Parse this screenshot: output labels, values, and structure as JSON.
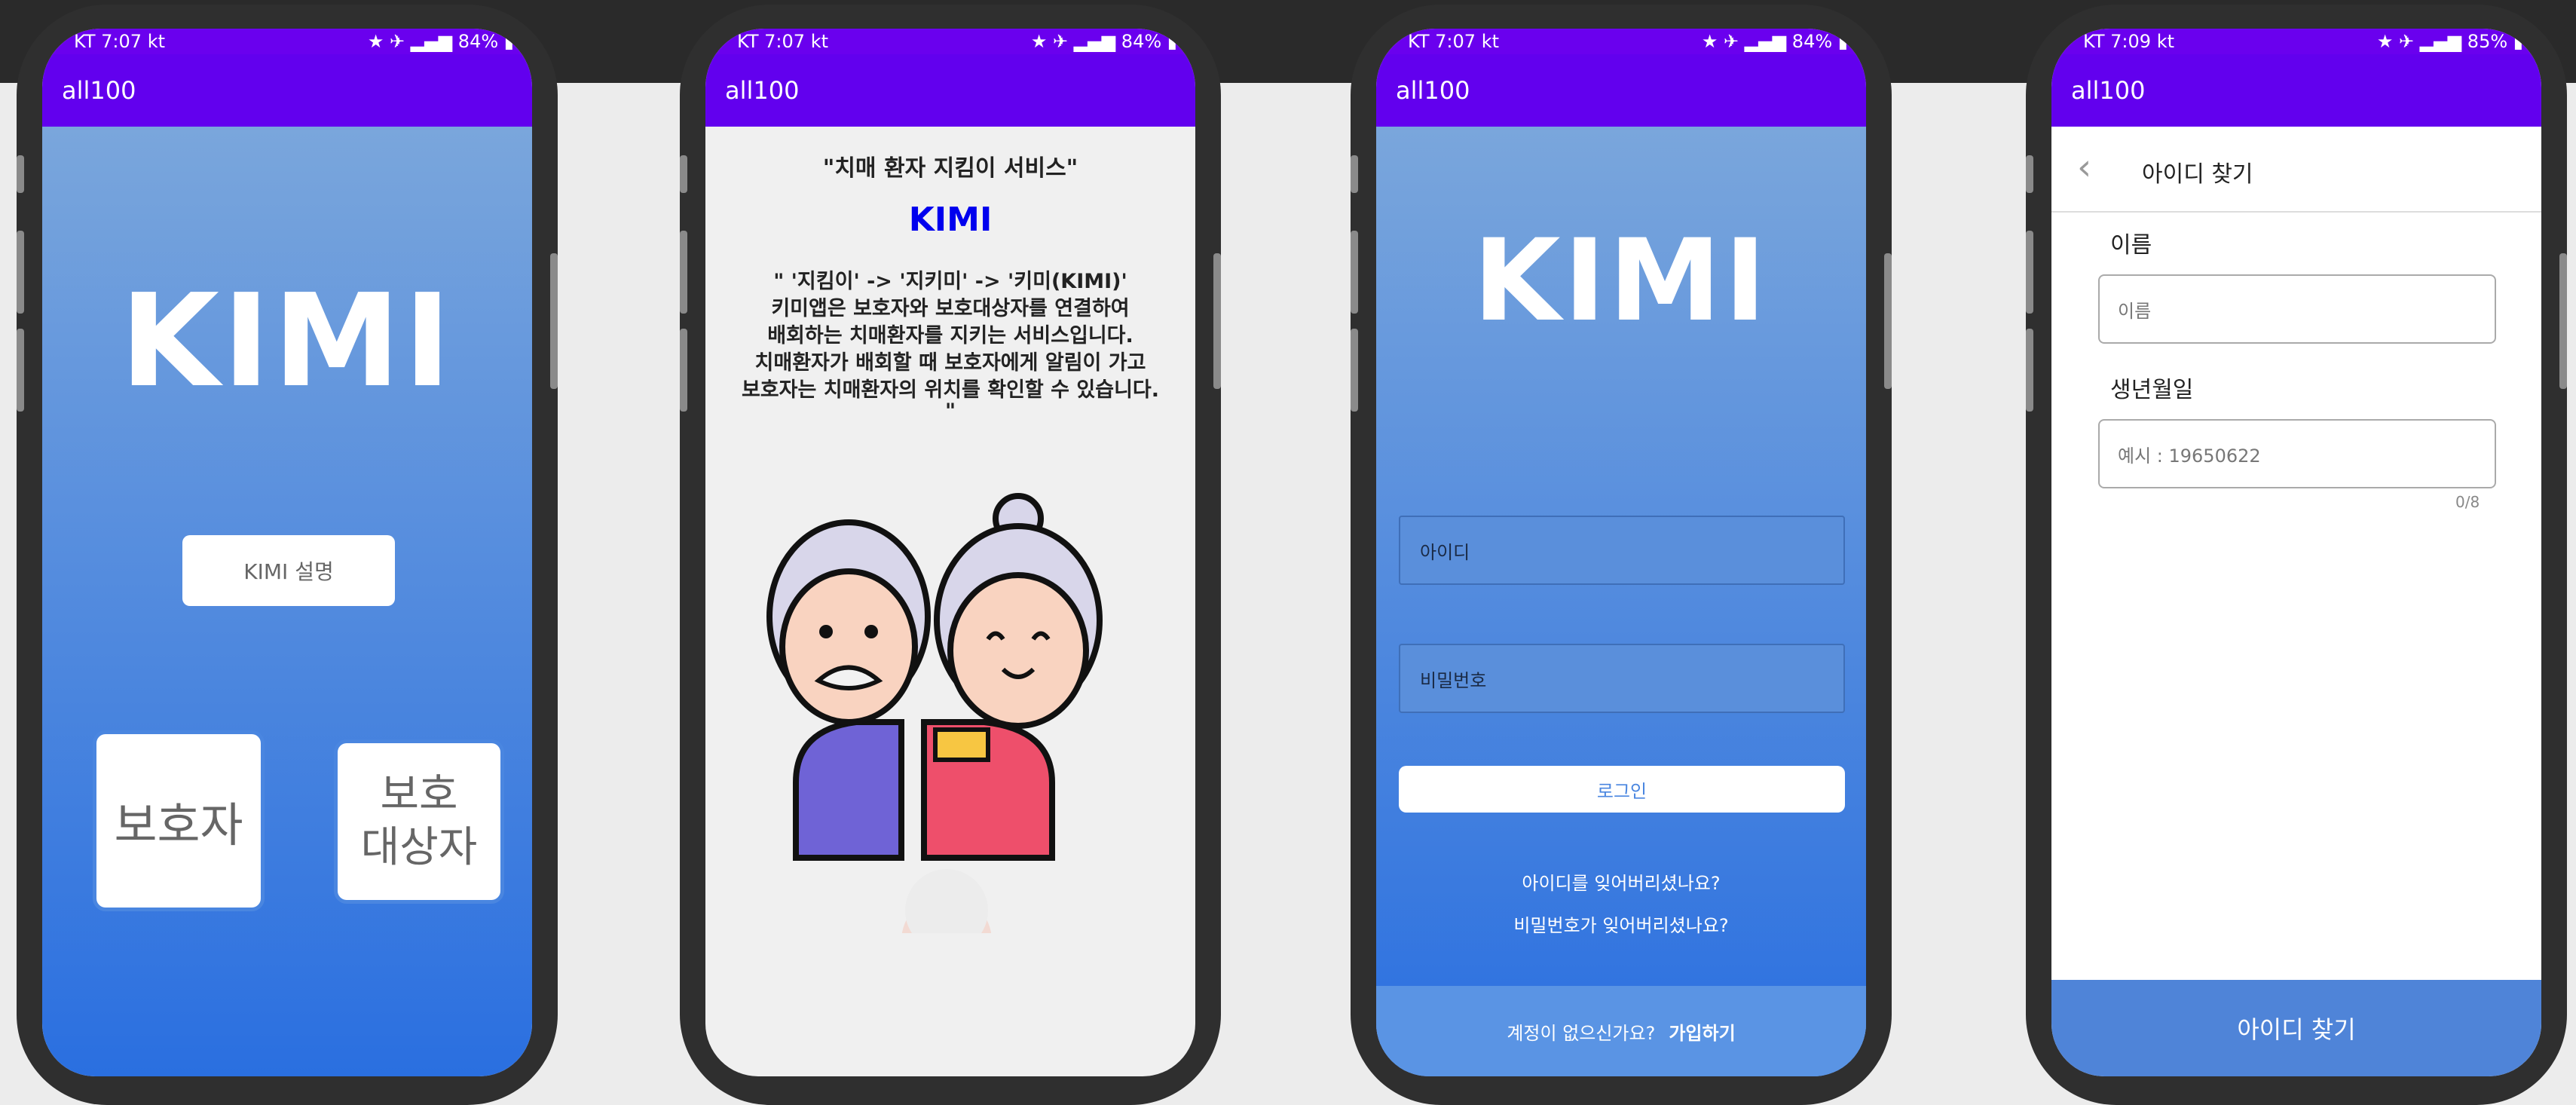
{
  "status": {
    "s1": {
      "left": "KT 7:07 kt",
      "right": "84%"
    },
    "s2": {
      "left": "KT 7:07 kt",
      "right": "84%"
    },
    "s3": {
      "left": "KT 7:07 kt",
      "right": "84%"
    },
    "s4": {
      "left": "KT 7:09 kt",
      "right": "85%"
    }
  },
  "app_title": "all100",
  "screen1": {
    "logo": "KIMI",
    "about_button": "KIMI 설명",
    "guardian_button": "보호자",
    "ward_button_line1": "보호",
    "ward_button_line2": "대상자"
  },
  "screen2": {
    "heading": "\"치매 환자 지킴이 서비스\"",
    "brand": "KIMI",
    "desc": [
      "\" '지킴이' -> '지키미' -> '키미(KIMI)'",
      "키미앱은 보호자와 보호대상자를 연결하여",
      "배회하는 치매환자를 지키는 서비스입니다.",
      "치매환자가 배회할 때 보호자에게 알림이 가고",
      "보호자는 치매환자의 위치를 확인할 수 있습니다.",
      "\""
    ]
  },
  "screen3": {
    "logo": "KIMI",
    "id_placeholder": "아이디",
    "pw_placeholder": "비밀번호",
    "login_button": "로그인",
    "forgot_id": "아이디를 잊어버리셨나요?",
    "forgot_pw": "비밀번호가 잊어버리셨나요?",
    "no_account": "계정이 없으신가요?",
    "signup": "가입하기"
  },
  "screen4": {
    "title": "아이디 찾기",
    "name_label": "이름",
    "name_placeholder": "이름",
    "birth_label": "생년월일",
    "birth_placeholder": "예시 : 19650622",
    "counter": "0/8",
    "submit_button": "아이디 찾기"
  },
  "colors": {
    "appbar": "#6200ee",
    "gradient_top": "#7aa6dc",
    "gradient_bottom": "#2a6fe0",
    "brand_blue": "#0000ee",
    "find_id_button": "#4f84d8"
  },
  "icons": [
    "battery-icon",
    "signal-icon",
    "wifi-icon",
    "back-chevron-icon",
    "elderly-couple-illustration"
  ]
}
